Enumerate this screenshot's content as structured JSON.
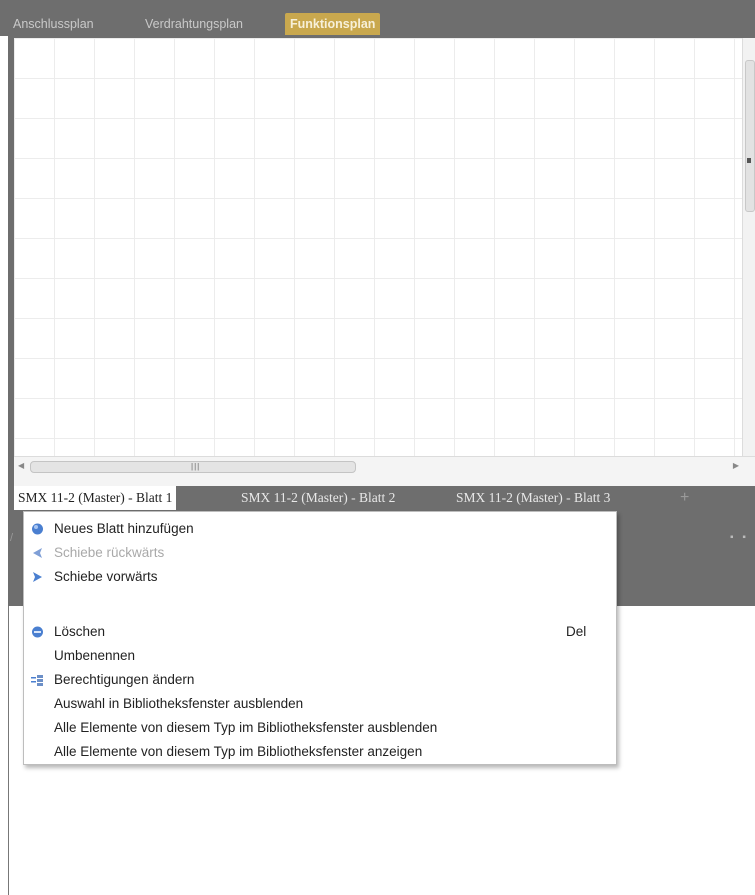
{
  "top_tabs": [
    {
      "label": "Anschlussplan",
      "active": false
    },
    {
      "label": "Verdrahtungsplan",
      "active": false
    },
    {
      "label": "Funktionsplan",
      "active": true
    }
  ],
  "sheet_tabs": [
    {
      "label": "SMX 11-2 (Master) - Blatt 1",
      "active": true
    },
    {
      "label": "SMX 11-2 (Master) - Blatt 2",
      "active": false
    },
    {
      "label": "SMX 11-2 (Master) - Blatt 3",
      "active": false
    }
  ],
  "add_sheet_symbol": "+",
  "context_menu": {
    "items": [
      {
        "label": "Neues Blatt hinzufügen",
        "icon": "add-sheet-icon",
        "enabled": true
      },
      {
        "label": "Schiebe rückwärts",
        "icon": "move-back-icon",
        "enabled": false
      },
      {
        "label": "Schiebe vorwärts",
        "icon": "move-forward-icon",
        "enabled": true
      },
      {
        "label": "Löschen",
        "icon": "delete-icon",
        "shortcut": "Del",
        "enabled": true
      },
      {
        "label": "Umbenennen",
        "enabled": true
      },
      {
        "label": "Berechtigungen ändern",
        "icon": "permissions-icon",
        "enabled": true
      },
      {
        "label": "Auswahl in Bibliotheksfenster ausblenden",
        "enabled": true
      },
      {
        "label": "Alle Elemente von diesem Typ im Bibliotheksfenster ausblenden",
        "enabled": true
      },
      {
        "label": "Alle Elemente von diesem Typ im Bibliotheksfenster anzeigen",
        "enabled": true
      }
    ]
  },
  "colors": {
    "chrome": "#6e6e6e",
    "active_tab": "#c9a84e",
    "icon_blue": "#4a7fd0"
  }
}
